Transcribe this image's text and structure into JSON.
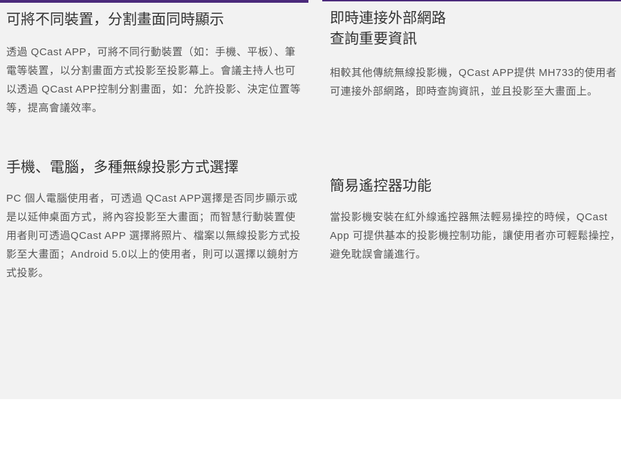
{
  "features": [
    {
      "title": "可將不同裝置，分割畫面同時顯示",
      "body": "透過 QCast APP，可將不同行動裝置（如：手機、平板）、筆電等裝置，以分割畫面方式投影至投影幕上。會議主持人也可以透過 QCast APP控制分割畫面，如：允許投影、決定位置等等，提高會議效率。"
    },
    {
      "title": "即時連接外部網路\n查詢重要資訊",
      "body": "相較其他傳統無線投影機，QCast APP提供 MH733的使用者可連接外部網路，即時查詢資訊，並且投影至大畫面上。"
    },
    {
      "title": "手機、電腦，多種無線投影方式選擇",
      "body": "PC 個人電腦使用者，可透過 QCast APP選擇是否同步顯示或是以延伸桌面方式，將內容投影至大畫面；而智慧行動裝置使用者則可透過QCast APP 選擇將照片、檔案以無線投影方式投影至大畫面；Android 5.0以上的使用者，則可以選擇以鏡射方式投影。"
    },
    {
      "title": "簡易遙控器功能",
      "body": "當投影機安裝在紅外線遙控器無法輕易操控的時候，QCast App 可提供基本的投影機控制功能，讓使用者亦可輕鬆操控，避免耽誤會議進行。"
    }
  ]
}
